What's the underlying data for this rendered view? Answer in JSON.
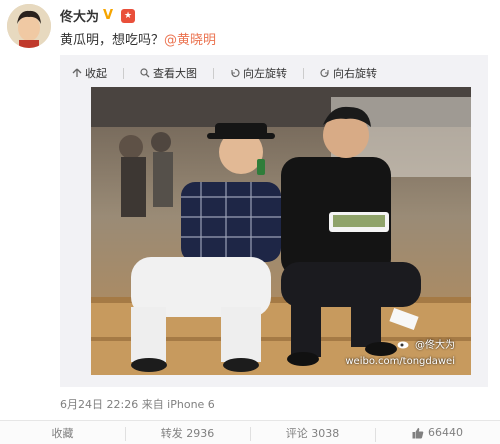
{
  "post": {
    "author": "佟大为",
    "text": "黄瓜明，想吃吗？",
    "mention": "@黄晓明",
    "level_badge": "★",
    "meta": "6月24日 22:26 来自 iPhone 6"
  },
  "toolbar": {
    "collapse": "收起",
    "view_large": "查看大图",
    "rotate_left": "向左旋转",
    "rotate_right": "向右旋转"
  },
  "watermark": {
    "name": "@佟大为",
    "url": "weibo.com/tongdawei"
  },
  "actions": {
    "favorite": "收藏",
    "repost": "转发 2936",
    "comment": "评论 3038",
    "like": "66440"
  },
  "colors": {
    "mention": "#eb7350",
    "badge_v": "#f6a500",
    "badge_level": "#e94f3a",
    "meta_text": "#808080"
  },
  "icons": {
    "collapse": "arrow-up-icon",
    "view_large": "magnifier-icon",
    "rotate_left": "rotate-left-icon",
    "rotate_right": "rotate-right-icon",
    "like": "thumbs-up-icon",
    "verified": "verified-v-icon",
    "level": "level-badge-icon"
  }
}
